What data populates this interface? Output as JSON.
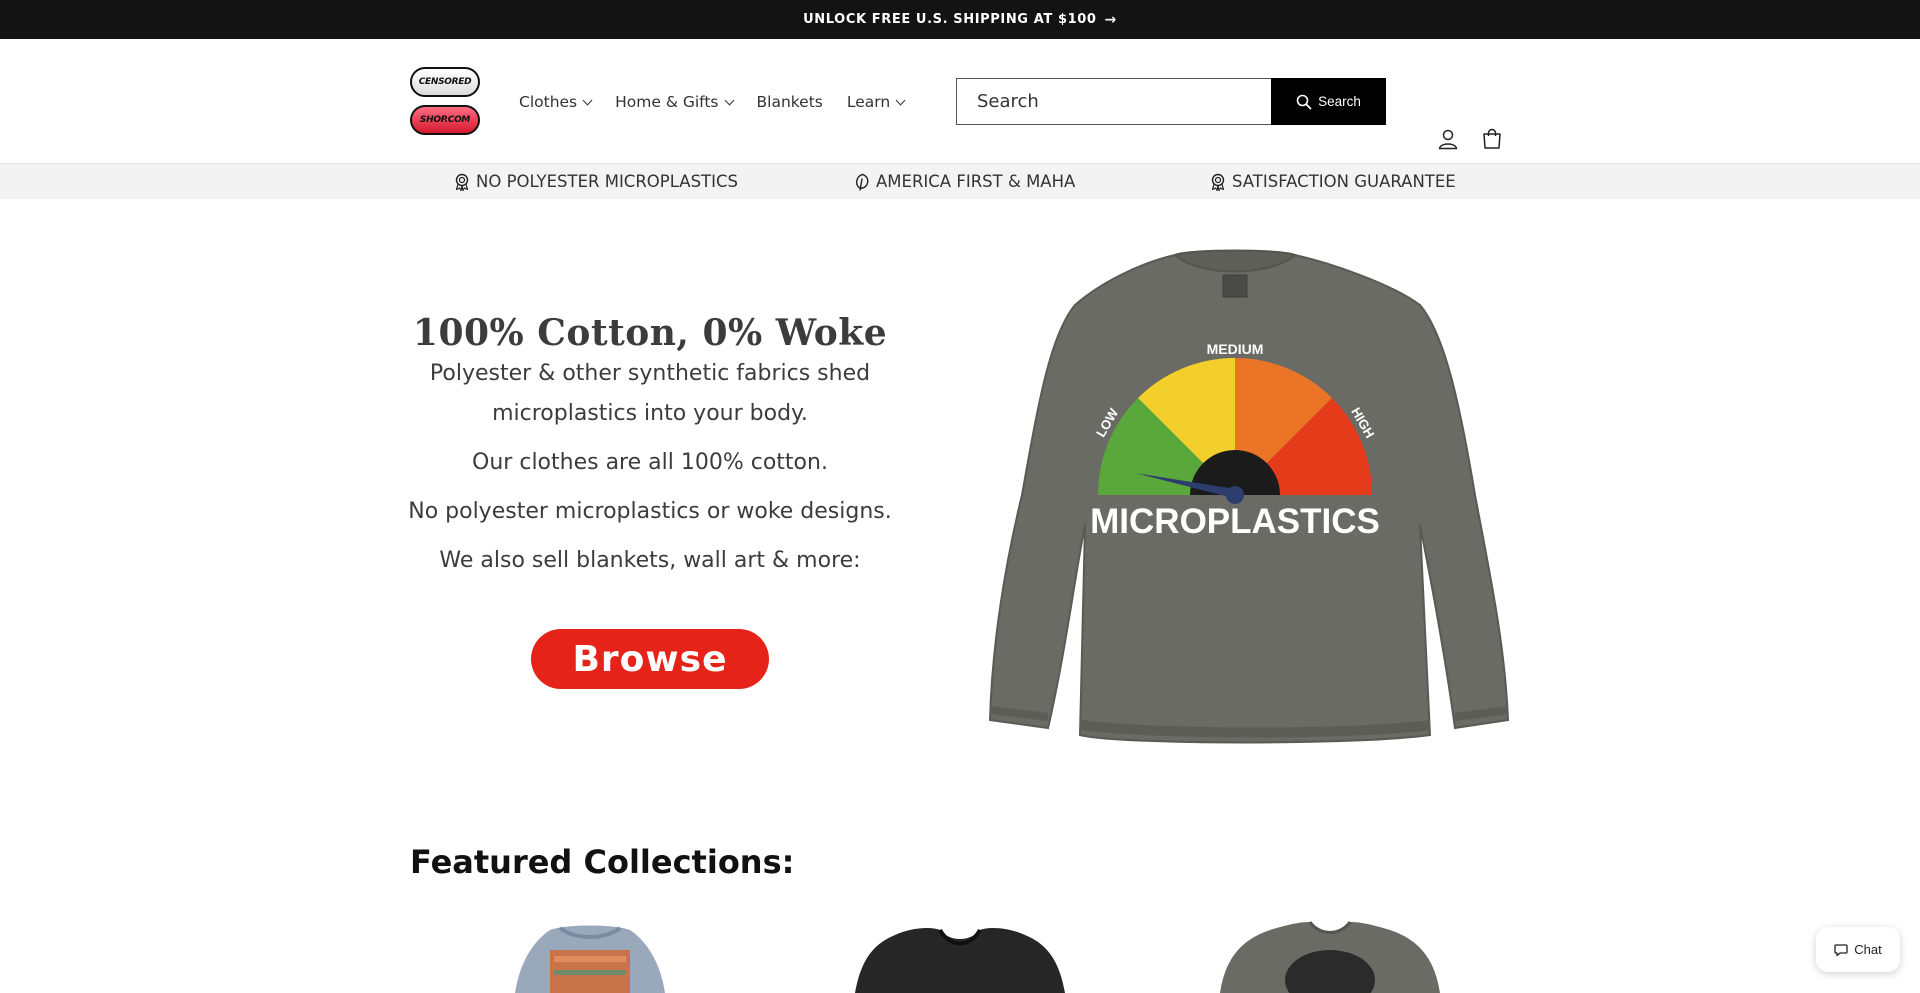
{
  "announcement": {
    "text": "UNLOCK FREE U.S. SHIPPING AT $100"
  },
  "logo": {
    "top_text": "CENSORED",
    "bottom_text": "SHOP.COM"
  },
  "nav": {
    "items": [
      {
        "label": "Clothes",
        "dropdown": true
      },
      {
        "label": "Home & Gifts",
        "dropdown": true
      },
      {
        "label": "Blankets",
        "dropdown": false
      },
      {
        "label": "Learn",
        "dropdown": true
      }
    ]
  },
  "search": {
    "placeholder": "Search",
    "button_label": "Search"
  },
  "header_icons": [
    "account-icon",
    "cart-icon"
  ],
  "trust_bar": [
    {
      "icon": "badge-icon",
      "label": "NO POLYESTER MICROPLASTICS"
    },
    {
      "icon": "leaf-icon",
      "label": "AMERICA FIRST & MAHA"
    },
    {
      "icon": "badge-icon",
      "label": "SATISFACTION GUARANTEE"
    }
  ],
  "hero": {
    "title": "100% Cotton, 0% Woke",
    "paragraphs": [
      "Polyester & other synthetic fabrics shed microplastics into your body.",
      "Our clothes are all 100% cotton.",
      "No polyester microplastics or woke designs.",
      "We also sell blankets, wall art & more:"
    ],
    "button_label": "Browse",
    "image": {
      "gauge_labels": {
        "low": "LOW",
        "medium": "MEDIUM",
        "high": "HIGH"
      },
      "caption": "MICROPLASTICS"
    }
  },
  "featured": {
    "heading": "Featured Collections:"
  },
  "chat": {
    "label": "Chat"
  },
  "colors": {
    "announcement_bg": "#131313",
    "browse_button": "#e62318",
    "trust_bar_bg": "#f3f3f3",
    "sweater": "#6b6b66"
  }
}
